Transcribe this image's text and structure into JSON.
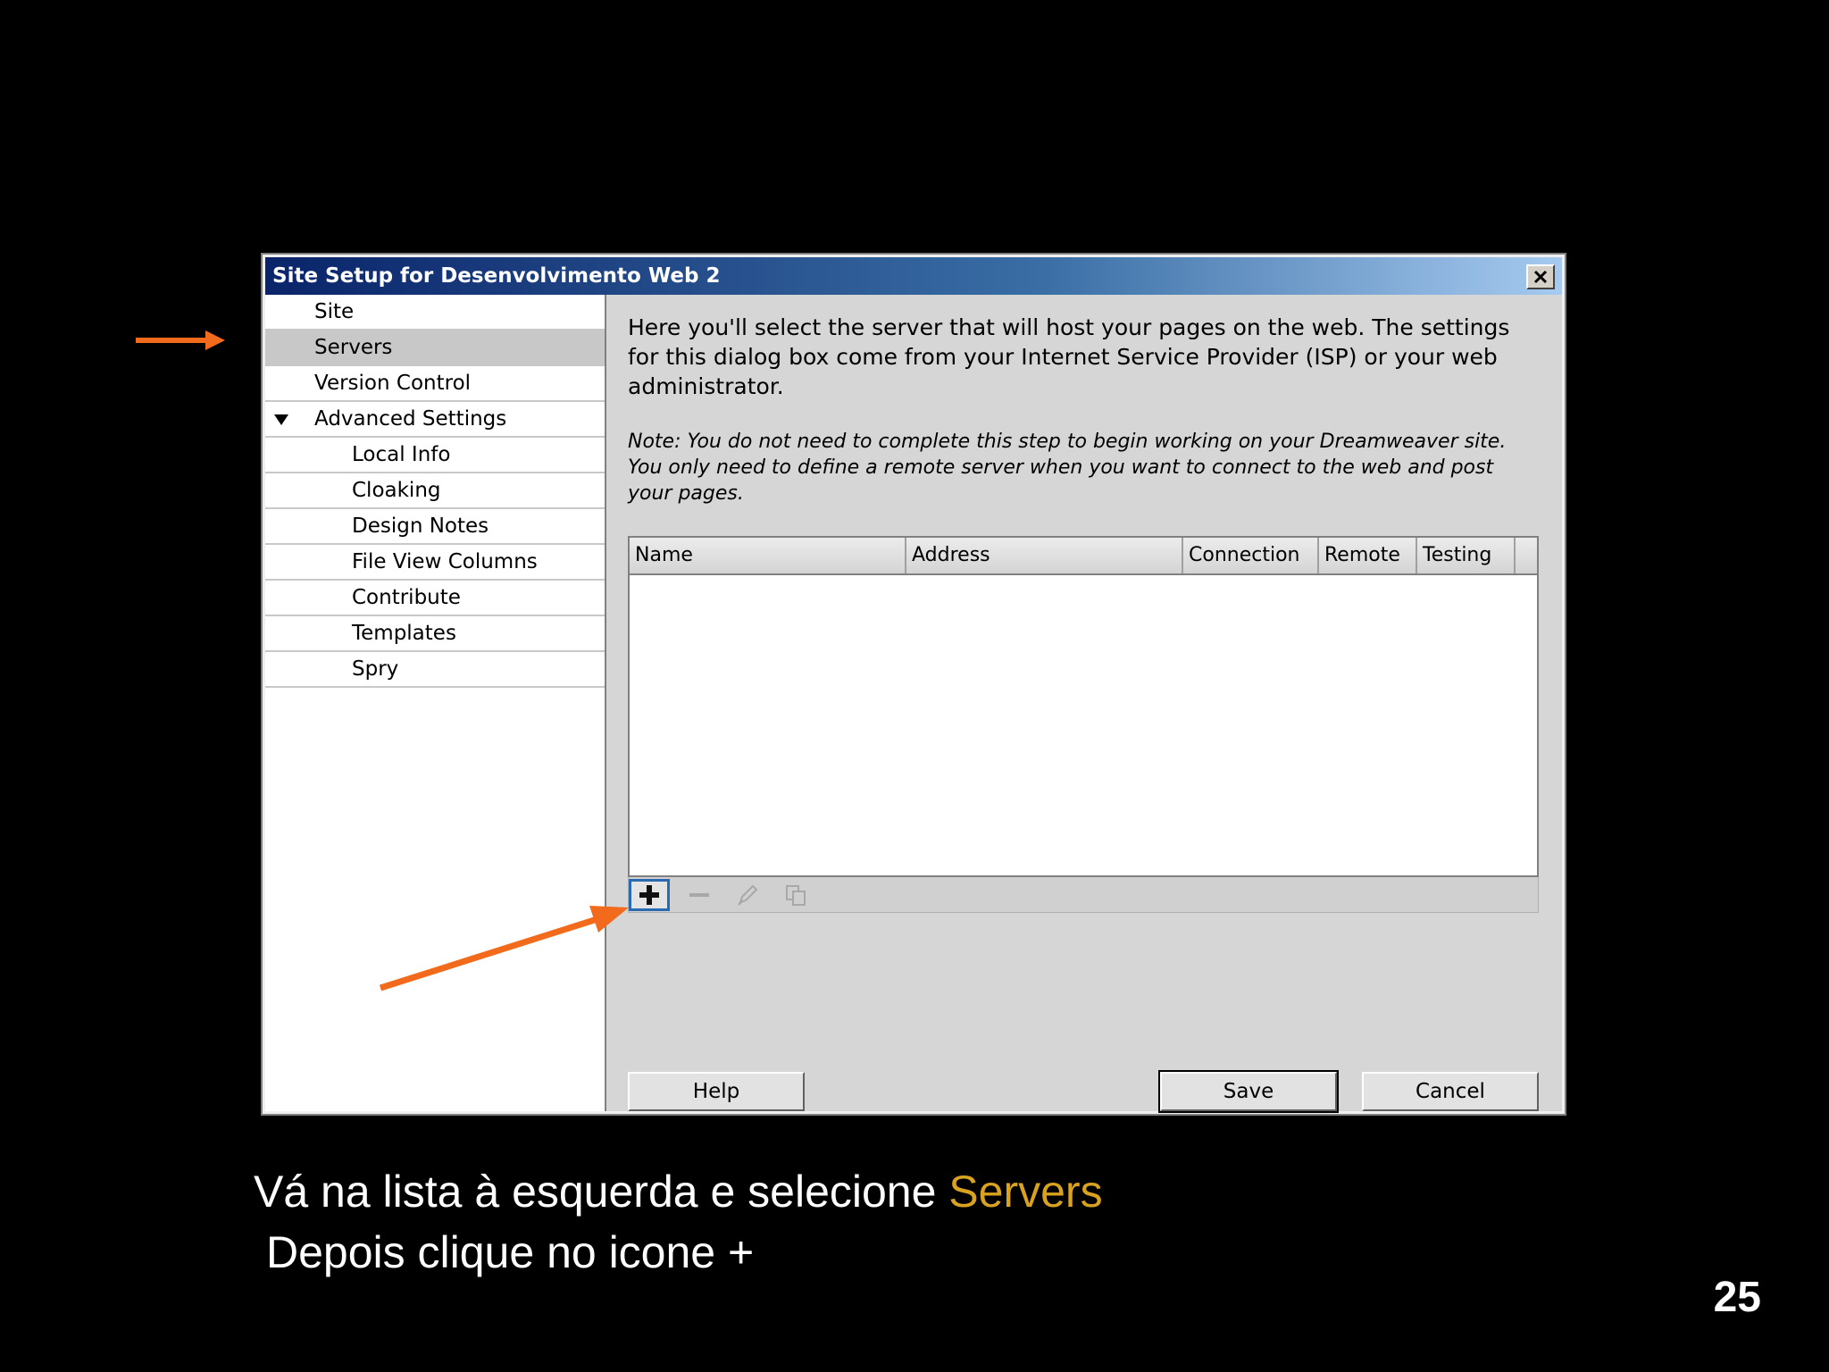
{
  "dialog": {
    "title": "Site Setup for Desenvolvimento Web 2",
    "close_icon": "close-icon"
  },
  "sidebar": {
    "items": [
      {
        "label": "Site",
        "selected": false,
        "level": 0
      },
      {
        "label": "Servers",
        "selected": true,
        "level": 0
      },
      {
        "label": "Version Control",
        "selected": false,
        "level": 0
      },
      {
        "label": "Advanced Settings",
        "selected": false,
        "level": 0,
        "expanded": true
      },
      {
        "label": "Local Info",
        "selected": false,
        "level": 1
      },
      {
        "label": "Cloaking",
        "selected": false,
        "level": 1
      },
      {
        "label": "Design Notes",
        "selected": false,
        "level": 1
      },
      {
        "label": "File View Columns",
        "selected": false,
        "level": 1
      },
      {
        "label": "Contribute",
        "selected": false,
        "level": 1
      },
      {
        "label": "Templates",
        "selected": false,
        "level": 1
      },
      {
        "label": "Spry",
        "selected": false,
        "level": 1
      }
    ]
  },
  "content": {
    "description": "Here you'll select the server that will host your pages on the web. The settings for this dialog box come from your Internet Service Provider (ISP) or your web administrator.",
    "note": "Note: You do not need to complete this step to begin working on your Dreamweaver site. You only need to define a remote server when you want to connect to the web and post your pages.",
    "table": {
      "columns": [
        "Name",
        "Address",
        "Connection",
        "Remote",
        "Testing"
      ]
    },
    "toolbar": {
      "add_icon": "plus-icon",
      "remove_icon": "minus-icon",
      "edit_icon": "pencil-icon",
      "duplicate_icon": "duplicate-icon"
    },
    "buttons": {
      "help": "Help",
      "save": "Save",
      "cancel": "Cancel"
    }
  },
  "caption": {
    "line1_prefix": "Vá na lista à esquerda e selecione ",
    "line1_highlight": "Servers",
    "line2": "Depois clique no icone +"
  },
  "page_number": "25",
  "colors": {
    "arrow": "#f26a1b",
    "highlight": "#d9a320"
  }
}
